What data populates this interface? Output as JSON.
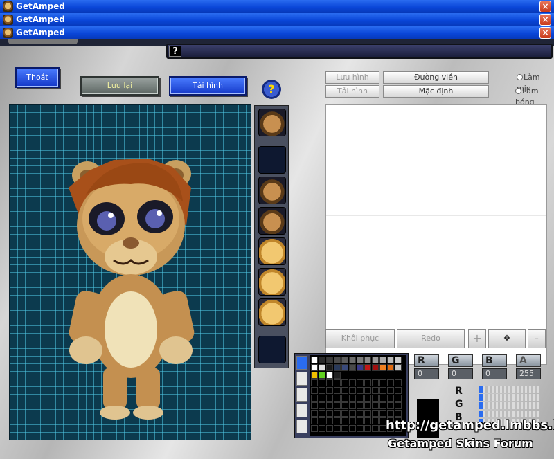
{
  "windows": [
    {
      "title": "GetAmped",
      "icon": "getamped-app-icon",
      "close": "×"
    },
    {
      "title": "GetAmped",
      "icon": "getamped-app-icon",
      "close": "×"
    },
    {
      "title": "GetAmped",
      "icon": "getamped-app-icon",
      "close": "×"
    }
  ],
  "helpbar": {
    "q": "?"
  },
  "toolbar": {
    "exit_label": "Thoát",
    "save_label": "Lưu lại",
    "reload_label": "Tải hình",
    "help": "?"
  },
  "texture_panel": {
    "save_image": "Lưu hình",
    "load_image": "Tải hình",
    "outline": "Đường viền",
    "default": "Mặc định",
    "smooth": "Làm mịn",
    "shade": "Làm bóng",
    "restore": "Khôi phục",
    "redo": "Redo",
    "plus": "+",
    "minus": "-"
  },
  "parts": [
    "character-head-portrait",
    "empty-slot",
    "hand-part",
    "armor-part",
    "face-angry",
    "face-neutral",
    "face-sad",
    "empty-slot"
  ],
  "channels": {
    "r": {
      "label": "R",
      "value": "0"
    },
    "g": {
      "label": "G",
      "value": "0"
    },
    "b": {
      "label": "B",
      "value": "0"
    },
    "a": {
      "label": "A",
      "value": "255"
    }
  },
  "sliders": {
    "r": "R",
    "g": "G",
    "b": "B"
  },
  "palette": {
    "row1": [
      "#ffffff",
      "#2a2a2a",
      "#3a3a3a",
      "#4a4a4a",
      "#5a5a5a",
      "#6a6a6a",
      "#7a7a7a",
      "#8a8a8a",
      "#9a9a9a",
      "#aaaaaa",
      "#bababa",
      "#cacaca"
    ],
    "row2": [
      "#ffffff",
      "#e0e0e0",
      "#1a1a1a",
      "#2a3a5a",
      "#3a4a7a",
      "#4a4a4a",
      "#3a3a8a",
      "#c01818",
      "#a01010",
      "#f08020",
      "#e06a10",
      "#c8c8c8"
    ],
    "row3": [
      "#f0c000",
      "#60d020",
      "#ffffff",
      "#202020"
    ]
  },
  "watermark": {
    "url": "http://getamped.imbbs.in",
    "forum": "Getamped Skins Forum"
  },
  "colors": {
    "titlebar": "#0a46d8",
    "grid_bg": "#0c3a4e",
    "grid_line": "#50c8e6",
    "button_blue": "#1438c8"
  }
}
